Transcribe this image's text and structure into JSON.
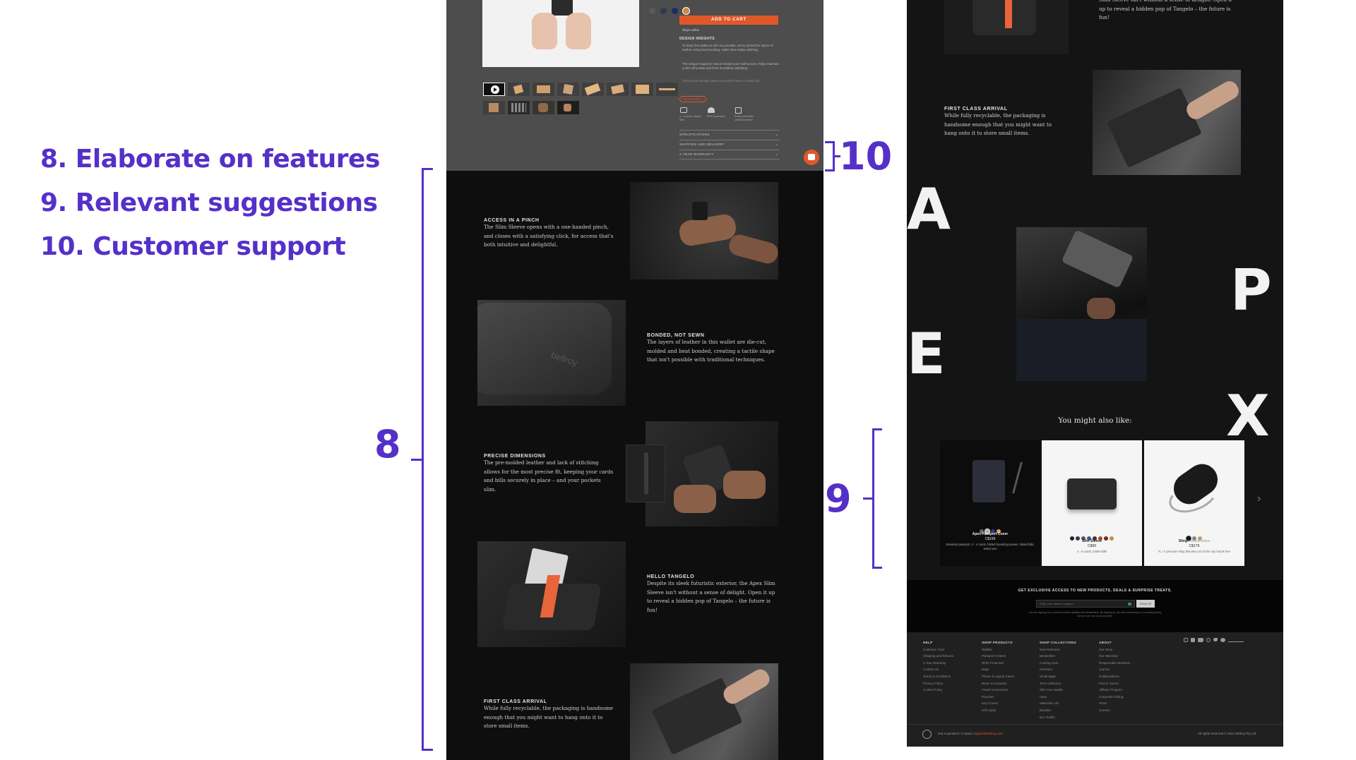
{
  "legend": {
    "item8": "8. Elaborate on features",
    "item9": "9. Relevant suggestions",
    "item10": "10. Customer support"
  },
  "brackets": {
    "label8": "8",
    "label9": "9",
    "label10": "10"
  },
  "colors": {
    "accent_purple": "#5530c8",
    "cart_orange": "#e0582a",
    "tangelo": "#e8643a"
  },
  "product_top": {
    "add_to_cart": "ADD TO CART",
    "ships_within": "Ships within",
    "design_insights_title": "DESIGN INSIGHTS",
    "insight_1": "To keep this wallet as slim as possible, we've joined the layers of leather using heat bonding, rather than bulky stitching.",
    "insight_2": "The unique magnetic closure keeps your stuff secure, helps maintain a slim silhouette and feels incredibly satisfying.",
    "insight_3": "The precise design means you won't have to break it in",
    "read_more": "READ MORE +",
    "feature_1": "4 - 8 cards, folded bills",
    "feature_2": "RFID protected",
    "feature_3": "Environmentally certified leather",
    "accordion": [
      "SPECIFICATIONS",
      "SHIPPING AND DELIVERY",
      "3 YEAR WARRANTY"
    ]
  },
  "feature_sections": [
    {
      "title": "ACCESS IN A PINCH",
      "body": "The Slim Sleeve opens with a one-handed pinch, and closes with a satisfying click, for access that's both intuitive and delightful."
    },
    {
      "title": "BONDED, NOT SEWN",
      "body": "The layers of leather in this wallet are die-cut, molded and heat bonded, creating a tactile shape that isn't possible with traditional techniques."
    },
    {
      "title": "PRECISE DIMENSIONS",
      "body": "The pre-molded leather and lack of stitching allows for the most precise fit, keeping your cards and bills securely in place – and your pockets slim."
    },
    {
      "title": "HELLO TANGELO",
      "body": "Despite its sleek futuristic exterior, the Apex Slim Sleeve isn't without a sense of delight. Open it up to reveal a hidden pop of Tangelo – the future is fun!"
    },
    {
      "title": "FIRST CLASS ARRIVAL",
      "body": "While fully recyclable, the packaging is handsome enough that you might want to hang onto it to store small items."
    }
  ],
  "panel2": {
    "top_text": "Slim Sleeve isn't without a sense of delight. Open it up to reveal a hidden pop of Tangelo – the future is fun!",
    "first_class_title": "FIRST CLASS ARRIVAL",
    "first_class_body": "While fully recyclable, the packaging is handsome enough that you might want to hang onto it to store small items.",
    "apex_letters": [
      "A",
      "P",
      "E",
      "X"
    ],
    "suggest_heading": "You might also like:",
    "cards": [
      {
        "name": "Apex Passport Cover",
        "price": "C$199",
        "desc": "Standard passport, 2 - 4 cards, folded boarding passes, folded bills, select pen"
      },
      {
        "name": "Slim Sleeve",
        "price": "C$99",
        "desc": "4 - 8 cards, folded bills"
      },
      {
        "name": "Sling",
        "badge": "Premium Edition",
        "price": "C$179",
        "desc": "7L / A premium sling that lets you hit the city hands free"
      }
    ],
    "next_arrow": "›",
    "newsletter_heading": "GET EXCLUSIVE ACCESS TO NEW PRODUCTS, DEALS & SURPRISE TREATS.",
    "newsletter_placeholder": "Enter your email to register",
    "newsletter_button": "SIGN UP",
    "newsletter_note": "You are signing up to receive product updates and newsletters. By signing up, you are consenting to our privacy policy but you can opt out at any time.",
    "footer_cols": [
      {
        "head": "HELP",
        "items": [
          "Customer Care",
          "Shipping and Returns",
          "3 Year Warranty",
          "Contact Us",
          "Terms & Conditions",
          "Privacy Policy",
          "Cookie Policy"
        ]
      },
      {
        "head": "SHOP PRODUCTS",
        "items": [
          "Wallets",
          "Passport Holders",
          "RFID Protected",
          "Bags",
          "Phone & Laptop Cases",
          "Work Accessories",
          "Travel Accessories",
          "Pouches",
          "Key Covers",
          "Gift Cards"
        ]
      },
      {
        "head": "SHOP COLLECTIONS",
        "items": [
          "New Releases",
          "Bestsellers",
          "Coming soon",
          "Premium",
          "Small Bags",
          "Tech Collection",
          "Slim Your Wallet",
          "Apex",
          "Materials Lab",
          "Bundles",
          "Eco Toolkit"
        ]
      },
      {
        "head": "ABOUT",
        "items": [
          "Our Story",
          "Our Warranty",
          "Responsible Business",
          "Journal",
          "Collaborations",
          "Find in Stores",
          "Affiliate Program",
          "Corporate Gifting",
          "Press",
          "Careers"
        ]
      }
    ],
    "footer_question": "Got a question? Contact",
    "footer_email": "support@bellroy.com",
    "footer_rights": "All rights reserved © 2021 Bellroy Pty Ltd."
  }
}
